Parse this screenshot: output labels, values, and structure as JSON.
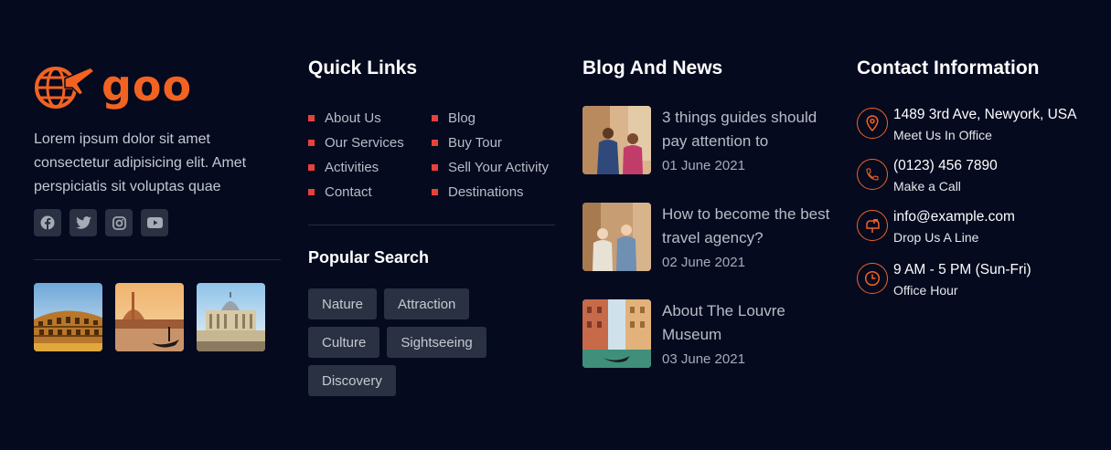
{
  "brand": {
    "name": "goo",
    "about": "Lorem ipsum dolor sit amet consectetur adipisicing elit. Amet perspiciatis sit voluptas quae",
    "socials": [
      "facebook-icon",
      "twitter-icon",
      "instagram-icon",
      "youtube-icon"
    ]
  },
  "gallery": [
    "colosseum",
    "venice",
    "vatican"
  ],
  "quick_links": {
    "title": "Quick Links",
    "left": [
      "About Us",
      "Our Services",
      "Activities",
      "Contact"
    ],
    "right": [
      "Blog",
      "Buy Tour",
      "Sell Your Activity",
      "Destinations"
    ]
  },
  "popular_search": {
    "title": "Popular Search",
    "tags": [
      "Nature",
      "Attraction",
      "Culture",
      "Sightseeing",
      "Discovery"
    ]
  },
  "blog": {
    "title": "Blog And News",
    "posts": [
      {
        "title": "3 things guides should pay attention to",
        "date": "01 June 2021"
      },
      {
        "title": "How to become the best travel agency?",
        "date": "02 June 2021"
      },
      {
        "title": "About The Louvre Museum",
        "date": "03 June 2021"
      }
    ]
  },
  "contact": {
    "title": "Contact Information",
    "items": [
      {
        "main": "1489 3rd Ave, Newyork, USA",
        "sub": "Meet Us In Office",
        "icon": "location-icon"
      },
      {
        "main": "(0123) 456 7890",
        "sub": "Make a Call",
        "icon": "phone-icon"
      },
      {
        "main": "info@example.com",
        "sub": "Drop Us A Line",
        "icon": "mailbox-icon"
      },
      {
        "main": "9 AM - 5 PM (Sun-Fri)",
        "sub": "Office Hour",
        "icon": "clock-icon"
      }
    ]
  },
  "colors": {
    "accent": "#f26322",
    "bullet": "#e8413d",
    "background": "#050a1f"
  }
}
